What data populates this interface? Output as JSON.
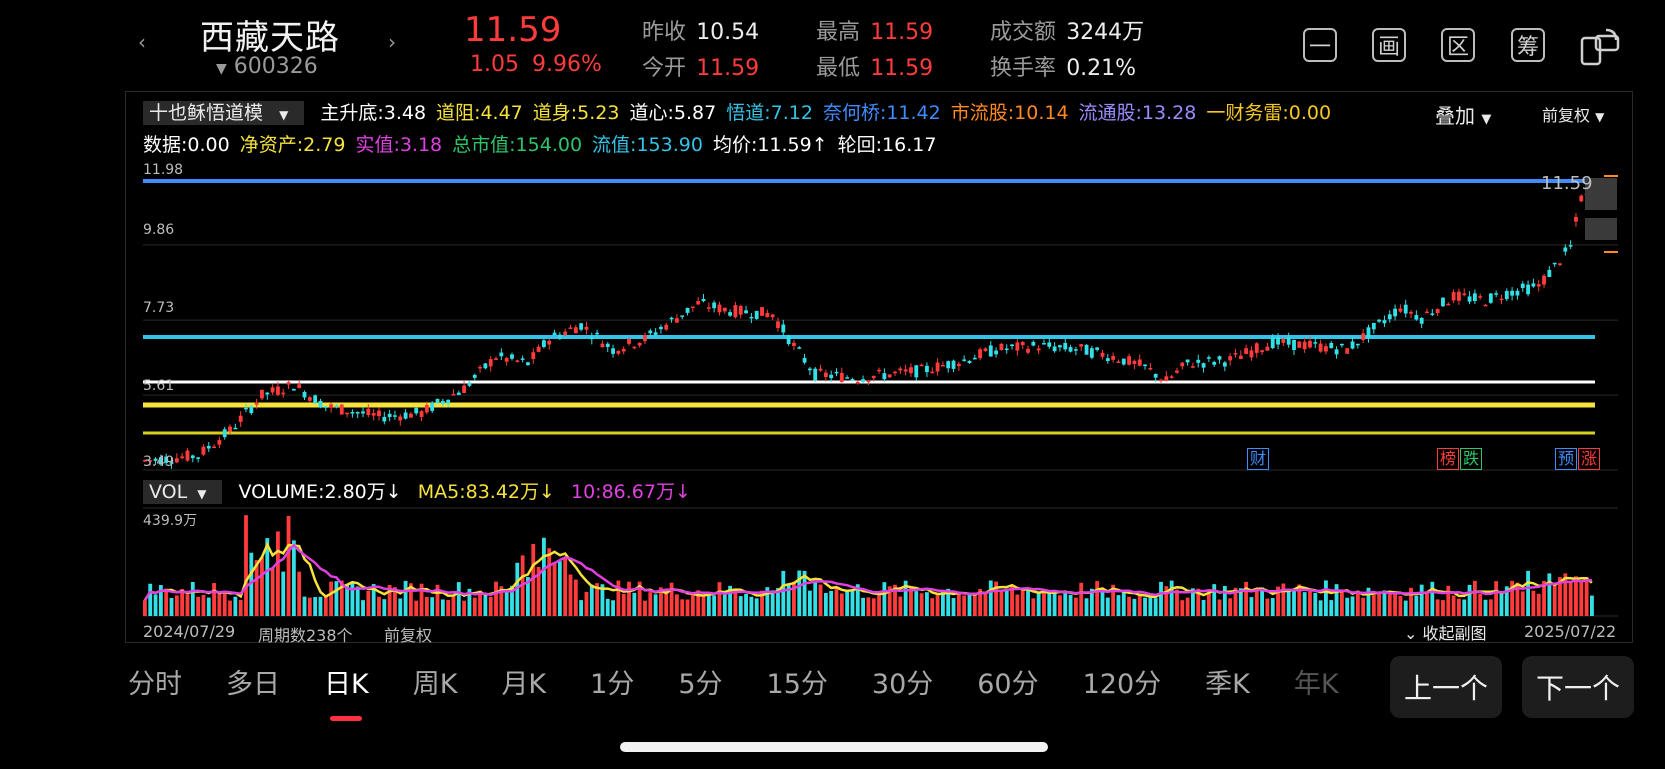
{
  "header": {
    "prev_arrow": "‹",
    "next_arrow": "›",
    "stock_name": "西藏天路",
    "stock_code": "600326",
    "price": "11.59",
    "change": "1.05",
    "change_pct": "9.96%",
    "quotes": [
      {
        "label": "昨收",
        "value": "10.54",
        "color": "white"
      },
      {
        "label": "今开",
        "value": "11.59",
        "color": "red"
      },
      {
        "label": "最高",
        "value": "11.59",
        "color": "red"
      },
      {
        "label": "最低",
        "value": "11.59",
        "color": "red"
      },
      {
        "label": "成交额",
        "value": "3244万",
        "color": "white"
      },
      {
        "label": "换手率",
        "value": "0.21%",
        "color": "white"
      }
    ],
    "tools": [
      "一",
      "画",
      "区",
      "筹"
    ]
  },
  "indicator": {
    "name": "十也稣悟道模",
    "row1": [
      {
        "text": "主升底:3.48",
        "color": "#ffffff"
      },
      {
        "text": "道阻:4.47",
        "color": "#f5e23b"
      },
      {
        "text": "道身:5.23",
        "color": "#f5e23b"
      },
      {
        "text": "道心:5.87",
        "color": "#ffffff"
      },
      {
        "text": "悟道:7.12",
        "color": "#33c3e6"
      },
      {
        "text": "奈何桥:11.42",
        "color": "#3f8cff"
      },
      {
        "text": "市流股:10.14",
        "color": "#ff8a1f"
      },
      {
        "text": "流通股:13.28",
        "color": "#9a8cff"
      },
      {
        "text": "一财务雷:0.00",
        "color": "#f5c823"
      }
    ],
    "row2": [
      {
        "text": "数据:0.00",
        "color": "#ffffff"
      },
      {
        "text": "净资产:2.79",
        "color": "#f5e23b"
      },
      {
        "text": "实值:3.18",
        "color": "#e040e0"
      },
      {
        "text": "总市值:154.00",
        "color": "#2ec46a"
      },
      {
        "text": "流值:153.90",
        "color": "#33c3e6"
      },
      {
        "text": "均价:11.59↑",
        "color": "#ffffff"
      },
      {
        "text": "轮回:16.17",
        "color": "#ffffff"
      }
    ],
    "overlay_label": "叠加",
    "adjust_label": "前复权"
  },
  "price_chart": {
    "y_labels": [
      "11.98",
      "9.86",
      "7.73",
      "5.61",
      "3.49"
    ],
    "last_price_label": "11.59",
    "badges": [
      {
        "text": "财",
        "color": "#3f8cff"
      },
      {
        "text": "榜",
        "color": "#ff3b3b"
      },
      {
        "text": "跌",
        "color": "#2ec46a"
      },
      {
        "text": "预",
        "color": "#3f8cff"
      },
      {
        "text": "涨",
        "color": "#ff3b3b"
      }
    ]
  },
  "volume": {
    "name": "VOL",
    "volume_label": "VOLUME:2.80万↓",
    "ma5_label": "MA5:83.42万↓",
    "ma10_label": "10:86.67万↓",
    "max_label": "439.9万",
    "start_date": "2024/07/29",
    "period_count": "周期数238个",
    "adjust_label": "前复权",
    "collapse_label": "收起副图",
    "end_date": "2025/07/22"
  },
  "tabs": [
    "分时",
    "多日",
    "日K",
    "周K",
    "月K",
    "1分",
    "5分",
    "15分",
    "30分",
    "60分",
    "120分",
    "季K",
    "年K"
  ],
  "active_tab": "日K",
  "prev_button": "上一个",
  "next_button": "下一个",
  "colors": {
    "up": "#ff3b3b",
    "down": "#33e0e6",
    "ma5": "#f5e23b",
    "ma10": "#e040e0",
    "blue_line": "#3f8cff",
    "cyan_line": "#33c3e6"
  }
}
